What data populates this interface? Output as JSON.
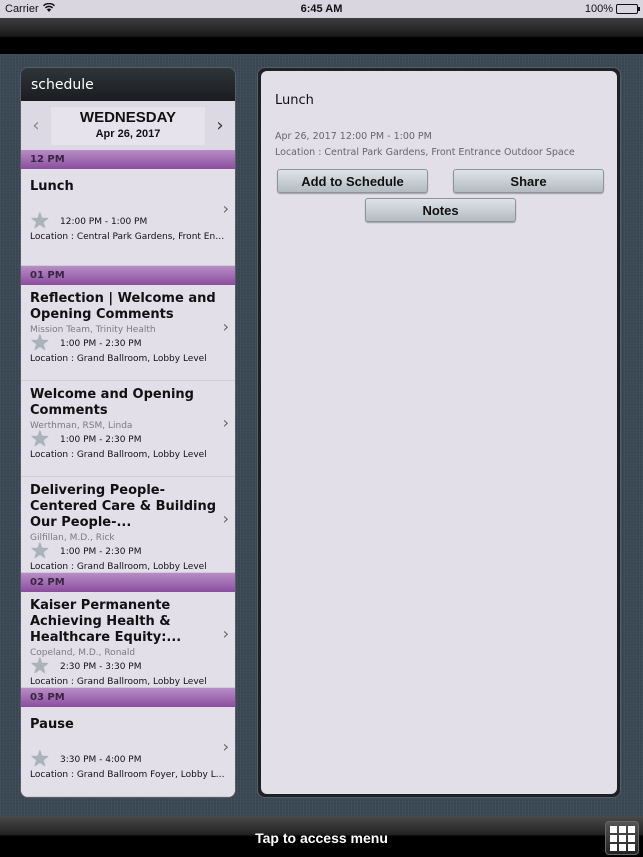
{
  "status_bar": {
    "carrier": "Carrier",
    "time": "6:45 AM",
    "battery": "100%",
    "battery_level": 1.0
  },
  "schedule": {
    "title": "schedule",
    "day_name": "WEDNESDAY",
    "date": "Apr 26, 2017",
    "prev_icon": "chevron-left-icon",
    "next_icon": "chevron-right-icon",
    "groups": [
      {
        "hour": "12 PM",
        "sessions": [
          {
            "title": "Lunch",
            "speaker": "",
            "time": "12:00 PM - 1:00 PM",
            "location": "Location : Central Park Gardens, Front Ent..."
          }
        ]
      },
      {
        "hour": "01 PM",
        "sessions": [
          {
            "title": "Reflection | Welcome and Opening Comments",
            "speaker": "Mission Team, Trinity Health",
            "time": "1:00 PM - 2:30 PM",
            "location": "Location : Grand Ballroom, Lobby Level"
          },
          {
            "title": "Welcome and Opening Comments",
            "speaker": "Werthman, RSM, Linda",
            "time": "1:00 PM - 2:30 PM",
            "location": "Location : Grand Ballroom, Lobby Level"
          },
          {
            "title": "Delivering People-Centered Care & Building Our People-...",
            "speaker": "Gilfillan, M.D., Rick",
            "time": "1:00 PM - 2:30 PM",
            "location": "Location : Grand Ballroom, Lobby Level"
          }
        ]
      },
      {
        "hour": "02 PM",
        "sessions": [
          {
            "title": "Kaiser Permanente Achieving Health & Healthcare Equity:...",
            "speaker": "Copeland, M.D., Ronald",
            "time": "2:30 PM - 3:30 PM",
            "location": "Location : Grand Ballroom, Lobby Level"
          }
        ]
      },
      {
        "hour": "03 PM",
        "sessions": [
          {
            "title": "Pause",
            "speaker": "",
            "time": "3:30 PM - 4:00 PM",
            "location": "Location : Grand Ballroom Foyer, Lobby Le..."
          }
        ]
      }
    ]
  },
  "detail": {
    "title": "Lunch",
    "datetime": "Apr 26, 2017 12:00 PM - 1:00 PM",
    "location": "Location : Central Park Gardens, Front Entrance Outdoor Space",
    "add_button": "Add to Schedule",
    "share_button": "Share",
    "notes_button": "Notes"
  },
  "bottom_bar": {
    "menu_label": "Tap to access menu",
    "menu_icon": "grid-menu-icon"
  }
}
